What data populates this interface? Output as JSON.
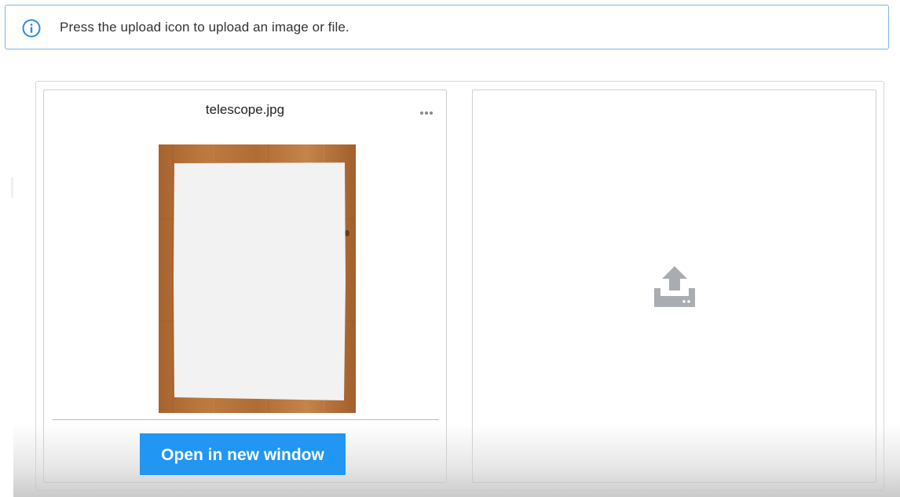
{
  "banner": {
    "icon": "info-icon",
    "message": "Press the upload icon to upload an image or file."
  },
  "file_card": {
    "file_name": "telescope.jpg",
    "menu_icon": "more-horizontal-icon",
    "preview_icon": "image-preview",
    "open_button_label": "Open in new window"
  },
  "upload_card": {
    "icon": "upload-icon"
  },
  "colors": {
    "accent": "#2196f3",
    "info_border": "#7fb2e5",
    "upload_icon": "#a9adb2"
  }
}
